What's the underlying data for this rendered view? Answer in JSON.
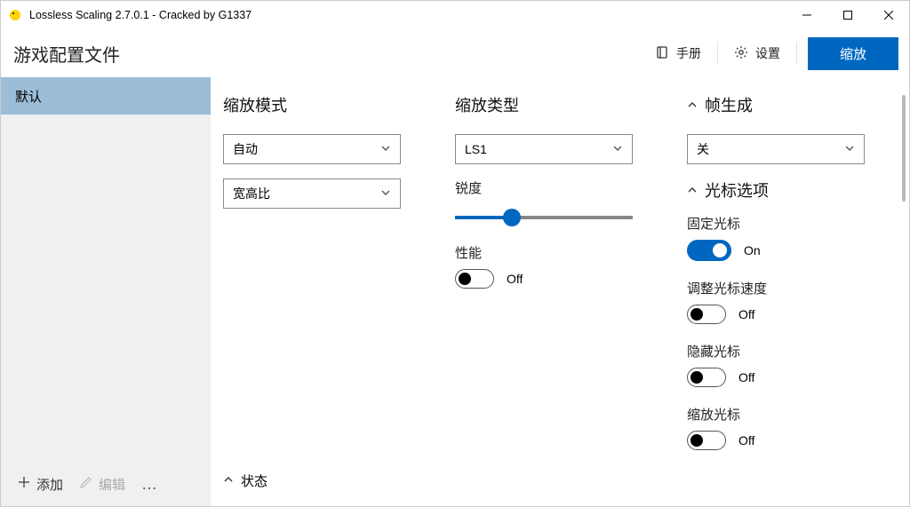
{
  "titlebar": {
    "title": "Lossless Scaling 2.7.0.1 - Cracked by G1337"
  },
  "toolbar": {
    "title": "游戏配置文件",
    "manual_label": "手册",
    "settings_label": "设置",
    "scale_label": "缩放"
  },
  "sidebar": {
    "items": [
      {
        "label": "默认"
      }
    ],
    "add_label": "添加",
    "edit_label": "编辑"
  },
  "col1": {
    "title": "缩放模式",
    "dropdown1": "自动",
    "dropdown2": "宽高比"
  },
  "col2": {
    "title": "缩放类型",
    "dropdown1": "LS1",
    "sharpness_label": "锐度",
    "performance_label": "性能",
    "performance_value": "Off"
  },
  "col3": {
    "framegen_title": "帧生成",
    "framegen_dropdown": "关",
    "cursor_title": "光标选项",
    "fixed_cursor_label": "固定光标",
    "fixed_cursor_value": "On",
    "adjust_speed_label": "调整光标速度",
    "adjust_speed_value": "Off",
    "hide_cursor_label": "隐藏光标",
    "hide_cursor_value": "Off",
    "scale_cursor_label": "缩放光标",
    "scale_cursor_value": "Off"
  },
  "status": {
    "label": "状态"
  }
}
